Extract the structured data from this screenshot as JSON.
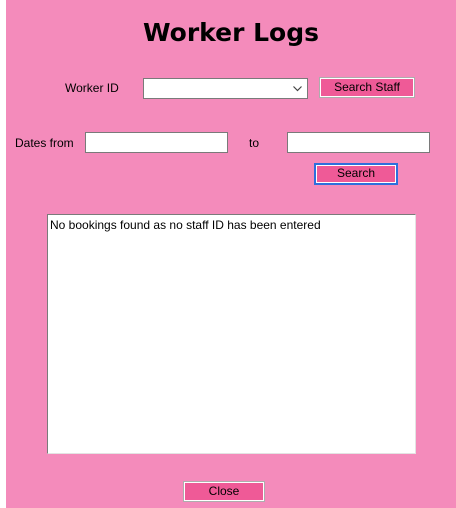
{
  "form": {
    "title": "Worker Logs",
    "worker_id_label": "Worker ID",
    "worker_id_value": "",
    "search_staff_label": "Search Staff",
    "dates_from_label": "Dates from",
    "dates_from_value": "",
    "to_label": "to",
    "dates_to_value": "",
    "search_label": "Search",
    "results_text": "No bookings found as no staff ID has been entered",
    "close_label": "Close"
  },
  "colors": {
    "background": "#f48bbb",
    "button": "#ef5a97",
    "focus_border": "#2d6fdc"
  },
  "icons": {
    "combo_arrow": "chevron-down-icon"
  }
}
